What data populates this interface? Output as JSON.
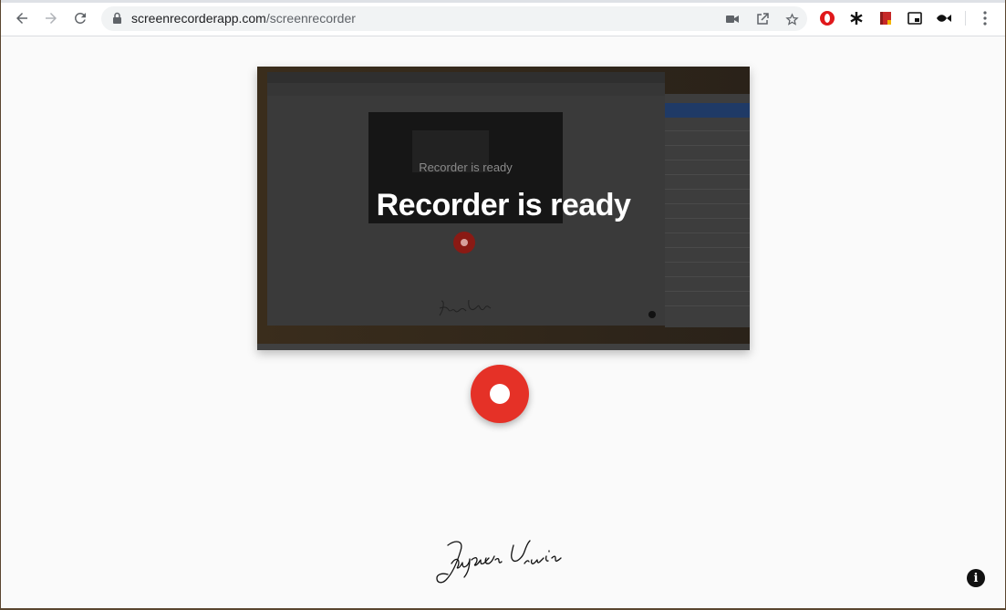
{
  "browser": {
    "url_host": "screenrecorderapp.com",
    "url_path": "/screenrecorder"
  },
  "preview": {
    "status_text": "Recorder is ready",
    "inner_status_text": "Recorder is ready"
  },
  "signature": {
    "text": "Jaydan Urwin"
  },
  "info": {
    "glyph": "i"
  },
  "colors": {
    "record_red": "#e53127",
    "page_background": "#fafafa"
  }
}
